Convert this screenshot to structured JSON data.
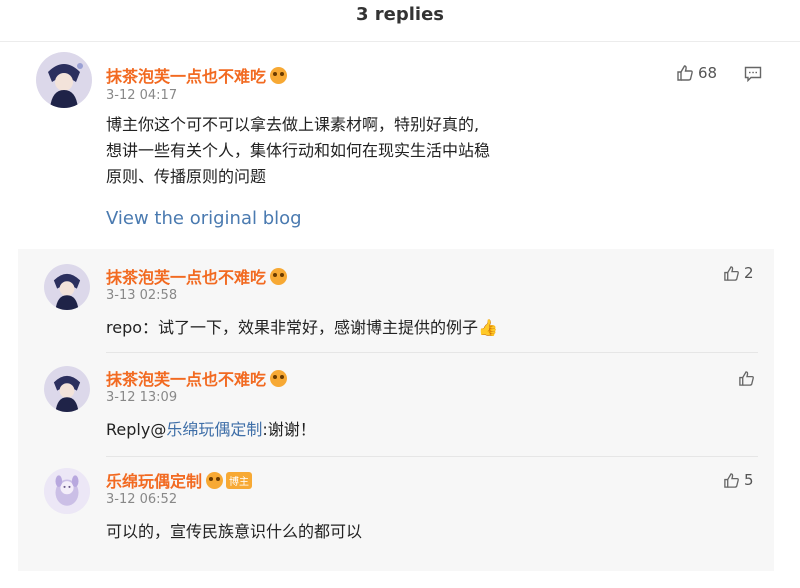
{
  "header": {
    "title": "3 replies"
  },
  "main_comment": {
    "username": "抹茶泡芙一点也不难吃",
    "time": "3-12 04:17",
    "lines": [
      "博主你这个可不可以拿去做上课素材啊，特别好真的,",
      "想讲一些有关个人，集体行动和如何在现实生活中站稳",
      "原则、传播原则的问题"
    ],
    "likes": "68",
    "view_original": "View the original blog"
  },
  "replies": [
    {
      "username": "抹茶泡芙一点也不难吃",
      "time": "3-13 02:58",
      "text": "repo：试了一下，效果非常好，感谢博主提供的例子👍",
      "likes": "2"
    },
    {
      "username": "抹茶泡芙一点也不难吃",
      "time": "3-12 13:09",
      "reply_prefix": "Reply@",
      "mention": "乐绵玩偶定制",
      "reply_rest": ":谢谢！",
      "likes": ""
    },
    {
      "username": "乐绵玩偶定制",
      "badge": "博主",
      "time": "3-12 06:52",
      "text": "可以的，宣传民族意识什么的都可以",
      "likes": "5"
    }
  ],
  "colors": {
    "username": "#f26a21",
    "link": "#4a7ab0",
    "reply_bg": "#f7f7f7"
  }
}
